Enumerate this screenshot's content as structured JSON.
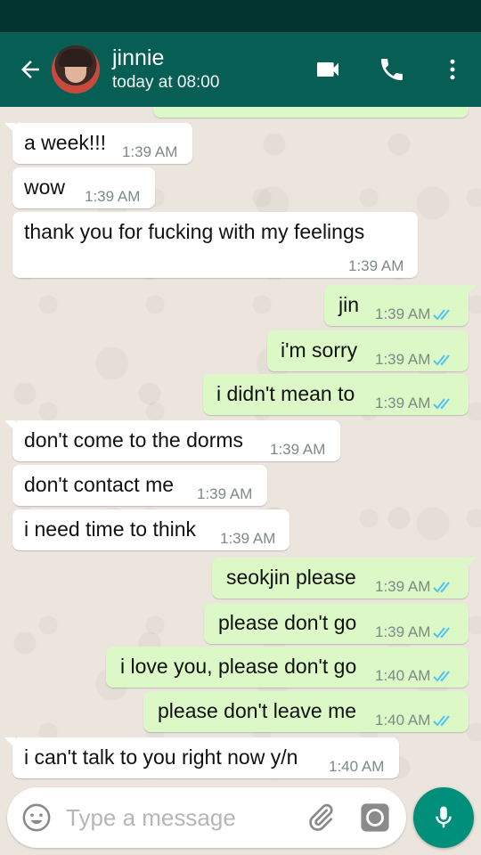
{
  "header": {
    "contact_name": "jinnie",
    "contact_status": "today at 08:00"
  },
  "messages": [
    {
      "dir": "in",
      "text": "a week!!!",
      "time": "1:39 AM"
    },
    {
      "dir": "in",
      "text": "wow",
      "time": "1:39 AM"
    },
    {
      "dir": "in",
      "text": "thank you for fucking with my feelings",
      "time": "1:39 AM"
    },
    {
      "dir": "out",
      "text": "jin",
      "time": "1:39 AM",
      "read": true
    },
    {
      "dir": "out",
      "text": "i'm sorry",
      "time": "1:39 AM",
      "read": true
    },
    {
      "dir": "out",
      "text": "i didn't mean to",
      "time": "1:39 AM",
      "read": true
    },
    {
      "dir": "in",
      "text": "don't come to the dorms",
      "time": "1:39 AM"
    },
    {
      "dir": "in",
      "text": "don't contact me",
      "time": "1:39 AM"
    },
    {
      "dir": "in",
      "text": "i need time to think",
      "time": "1:39 AM"
    },
    {
      "dir": "out",
      "text": "seokjin please",
      "time": "1:39 AM",
      "read": true
    },
    {
      "dir": "out",
      "text": "please don't go",
      "time": "1:39 AM",
      "read": true
    },
    {
      "dir": "out",
      "text": "i love you, please don't go",
      "time": "1:40 AM",
      "read": true
    },
    {
      "dir": "out",
      "text": "please don't leave me",
      "time": "1:40 AM",
      "read": true
    },
    {
      "dir": "in",
      "text": "i can't talk to you right now y/n",
      "time": "1:40 AM"
    }
  ],
  "composer": {
    "placeholder": "Type a message"
  },
  "icons": {
    "back": "arrow-left-icon",
    "video": "video-camera-icon",
    "call": "phone-icon",
    "menu": "more-vert-icon",
    "emoji": "emoji-icon",
    "attach": "paperclip-icon",
    "camera": "camera-icon",
    "mic": "microphone-icon"
  },
  "colors": {
    "app_bar": "#075e54",
    "status_bar": "#04342f",
    "outgoing_bubble": "#dcf8c6",
    "incoming_bubble": "#ffffff",
    "read_ticks": "#4fc3f7",
    "mic_button": "#008f7a"
  }
}
